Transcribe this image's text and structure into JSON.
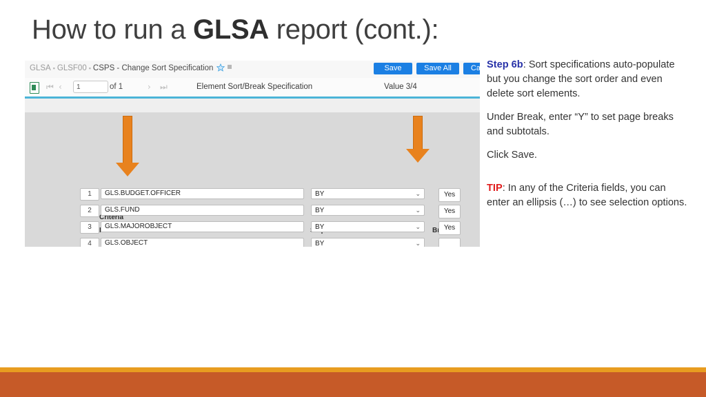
{
  "slide": {
    "title_before": "How to run a ",
    "title_strong": "GLSA",
    "title_after": " report (cont.):"
  },
  "app": {
    "breadcrumb": {
      "item1": "GLSA",
      "item2": "GLSF00",
      "current": "CSPS - Change Sort Specification",
      "separator": "▪"
    },
    "buttons": {
      "save": "Save",
      "save_all": "Save All",
      "cancel": "Cancel"
    },
    "nav": {
      "page_value": "1",
      "page_of": "of 1",
      "center_label": "Element Sort/Break Specification",
      "value_label": "Value 3/4",
      "first_glyph": "⏮",
      "prev_glyph": "‹",
      "next_glyph": "›",
      "last_glyph": "⏭"
    },
    "headers": {
      "criteria": "Criteria",
      "field_name": "Field Name",
      "sequence": "Sequence",
      "break": "Break"
    },
    "rows": [
      {
        "num": "1",
        "field": "GLS.BUDGET.OFFICER",
        "sequence": "BY",
        "break": "Yes"
      },
      {
        "num": "2",
        "field": "GLS.FUND",
        "sequence": "BY",
        "break": "Yes"
      },
      {
        "num": "3",
        "field": "GLS.MAJOROBJECT",
        "sequence": "BY",
        "break": "Yes"
      },
      {
        "num": "4",
        "field": "GLS.OBJECT",
        "sequence": "BY",
        "break": ""
      }
    ],
    "chevron_glyph": "⌄"
  },
  "notes": {
    "step_label": "Step 6b",
    "step_text": ": Sort specifications auto-populate but you change the sort order and even delete sort elements.",
    "para2": "Under Break, enter “Y” to set page breaks and subtotals.",
    "para3": "Click Save.",
    "tip_label": "TIP",
    "tip_text": ": In any of the Criteria fields, you can enter an ellipsis (…) to see selection options."
  },
  "colors": {
    "accent_blue": "#1b7fe3",
    "step_blue": "#2832a8",
    "tip_red": "#e01b1b",
    "arrow_orange": "#e8821e",
    "bar_gold": "#e89c20",
    "bar_orange": "#c65a28",
    "teal_rule": "#4bb4d8"
  }
}
